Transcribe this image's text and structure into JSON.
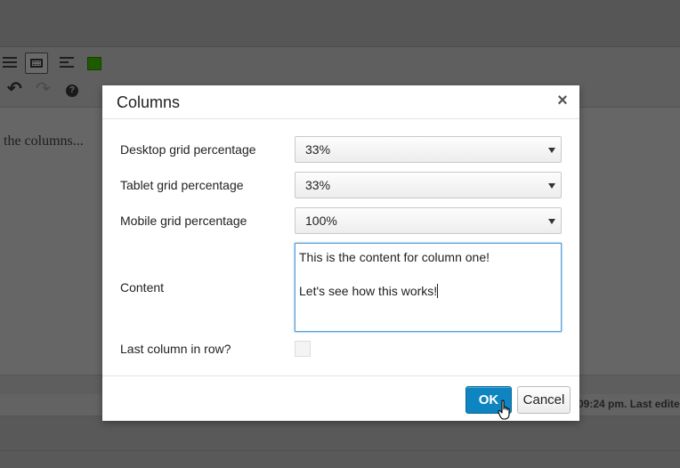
{
  "background": {
    "editor_text": "the columns...",
    "status_text": "09:24 pm. Last edite"
  },
  "toolbar": {
    "icons": [
      "horizontal-line-icon",
      "toolbar-toggle-icon",
      "align-icon",
      "color-swatch-icon",
      "undo-icon",
      "redo-icon",
      "help-icon"
    ],
    "swatch_color": "#1e5a00"
  },
  "dialog": {
    "title": "Columns",
    "close_label": "×",
    "fields": {
      "desktop": {
        "label": "Desktop grid percentage",
        "value": "33%"
      },
      "tablet": {
        "label": "Tablet grid percentage",
        "value": "33%"
      },
      "mobile": {
        "label": "Mobile grid percentage",
        "value": "100%"
      },
      "content": {
        "label": "Content",
        "line1": "This is the content for column one!",
        "line2": "Let's see how this works!"
      },
      "last_column": {
        "label": "Last column in row?",
        "checked": false
      }
    },
    "buttons": {
      "ok": "OK",
      "cancel": "Cancel"
    },
    "accent_color": "#0e84c0"
  }
}
